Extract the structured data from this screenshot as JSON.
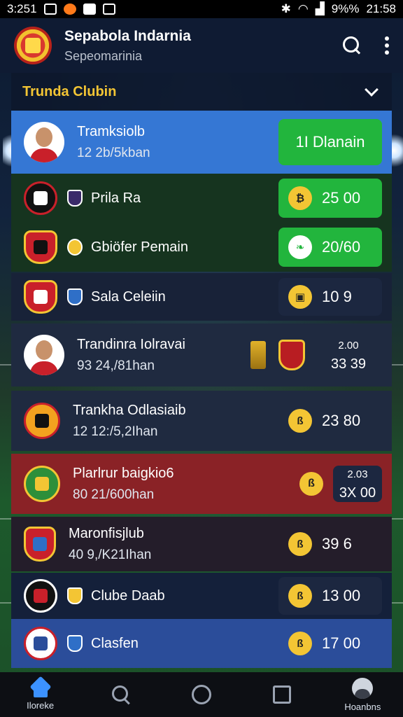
{
  "status_bar": {
    "time_left": "3:251",
    "battery": "9%%",
    "time_right": "21:58"
  },
  "header": {
    "title": "Sepabola Indarnia",
    "subtitle": "Sepeomarinia"
  },
  "section": {
    "title": "Trunda Clubin"
  },
  "featured": {
    "name": "Tramksiolb",
    "sub": "12  2b/5kban",
    "button": "1I Dlanain"
  },
  "rows": [
    {
      "name": "Prila Ra",
      "score": "25  00"
    },
    {
      "name": "Gbiöfer Pemain",
      "score": "20/60"
    },
    {
      "name": "Sala Celeiin",
      "score": "10  9"
    }
  ],
  "players": [
    {
      "name": "Trandinra Iolravai",
      "sub": "93  24,/81han",
      "score_top": "2.00",
      "score": "33 39"
    },
    {
      "name": "Trankha  Odlasiaib",
      "sub": "12  12:/5,2Ihan",
      "score": "23 80"
    },
    {
      "name": "Plarlrur baigkio6",
      "sub": "80  21/600han",
      "score_top": "2.03",
      "score": "3X 00"
    },
    {
      "name": "Maronfisjlub",
      "sub": "40  9,/K21Ihan",
      "score": "39  6"
    }
  ],
  "clubs": [
    {
      "name": "Clube Daab",
      "score": "13  00"
    },
    {
      "name": "Clasfen",
      "score": "17  00"
    }
  ],
  "nav": {
    "home": "Iloreke",
    "profile": "Hoanbns"
  },
  "colors": {
    "accent_yellow": "#f3c534",
    "green": "#22b53d",
    "blue_row": "#3577d4",
    "red_row": "#8a2226"
  }
}
